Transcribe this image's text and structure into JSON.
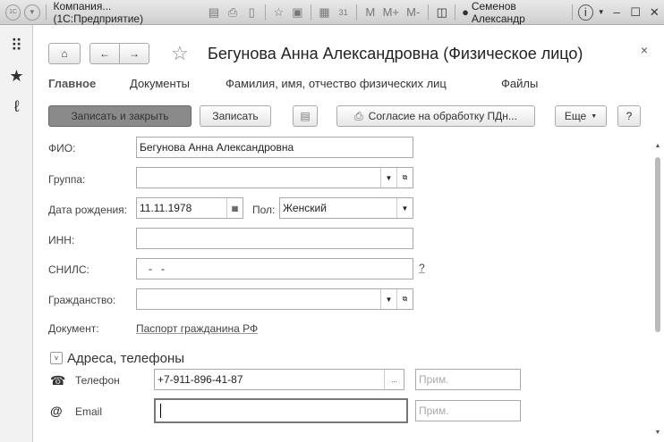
{
  "window": {
    "title": "Компания... (1С:Предприятие)",
    "user": "Семенов Александр",
    "m": "M",
    "mplus": "M+",
    "mminus": "M-"
  },
  "form": {
    "title": "Бегунова Анна Александровна (Физическое лицо)",
    "tabs": [
      "Главное",
      "Документы",
      "Фамилия, имя, отчество физических лиц",
      "Файлы"
    ],
    "buttons": {
      "save_close": "Записать и закрыть",
      "save": "Записать",
      "consent": "Согласие на обработку ПДн...",
      "more": "Еще",
      "help": "?"
    },
    "fields": {
      "fio_label": "ФИО:",
      "fio": "Бегунова Анна Александровна",
      "group_label": "Группа:",
      "group": "",
      "birth_label": "Дата рождения:",
      "birth": "11.11.1978",
      "sex_label": "Пол:",
      "sex": "Женский",
      "inn_label": "ИНН:",
      "inn": "",
      "snils_label": "СНИЛС:",
      "snils": "   -   -",
      "snils_help": "?",
      "citizenship_label": "Гражданство:",
      "citizenship": "",
      "document_label": "Документ:",
      "document": "Паспорт гражданина РФ"
    },
    "section": "Адреса, телефоны",
    "contacts": {
      "phone_label": "Телефон",
      "phone": "+7-911-896-41-87",
      "email_label": "Email",
      "email": "",
      "note_placeholder": "Прим.",
      "dots": "..."
    }
  }
}
